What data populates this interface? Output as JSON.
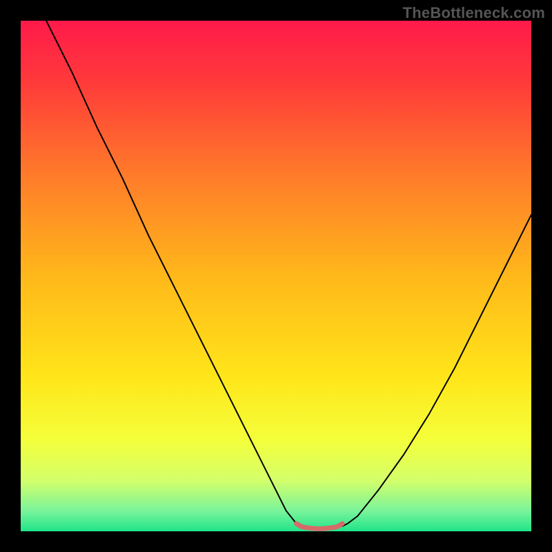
{
  "watermark": "TheBottleneck.com",
  "chart_data": {
    "type": "line",
    "title": "",
    "xlabel": "",
    "ylabel": "",
    "xlim": [
      0,
      100
    ],
    "ylim": [
      0,
      100
    ],
    "background_gradient": {
      "stops": [
        {
          "offset": 0.0,
          "color": "#ff1a4a"
        },
        {
          "offset": 0.12,
          "color": "#ff3a3a"
        },
        {
          "offset": 0.3,
          "color": "#ff7a2a"
        },
        {
          "offset": 0.5,
          "color": "#ffb81a"
        },
        {
          "offset": 0.7,
          "color": "#ffe61a"
        },
        {
          "offset": 0.82,
          "color": "#f4ff3a"
        },
        {
          "offset": 0.9,
          "color": "#d4ff6a"
        },
        {
          "offset": 0.96,
          "color": "#7af49a"
        },
        {
          "offset": 1.0,
          "color": "#20e48a"
        }
      ]
    },
    "series": [
      {
        "name": "curve-left",
        "stroke": "#000000",
        "stroke_width": 2,
        "x": [
          5,
          10,
          15,
          20,
          25,
          30,
          35,
          40,
          45,
          50,
          52,
          54,
          55
        ],
        "y": [
          100,
          90,
          79,
          69,
          58,
          48,
          38,
          28,
          18,
          8,
          4,
          1.5,
          1
        ]
      },
      {
        "name": "curve-right",
        "stroke": "#000000",
        "stroke_width": 2,
        "x": [
          63,
          64,
          66,
          70,
          75,
          80,
          85,
          90,
          95,
          100
        ],
        "y": [
          1,
          1.5,
          3,
          8,
          15,
          23,
          32,
          42,
          52,
          62
        ]
      },
      {
        "name": "valley-highlight",
        "stroke": "#d66a6a",
        "stroke_width": 7,
        "x": [
          54,
          55,
          56,
          57,
          58,
          59,
          60,
          61,
          62,
          63
        ],
        "y": [
          1.5,
          0.9,
          0.7,
          0.6,
          0.5,
          0.5,
          0.6,
          0.7,
          0.9,
          1.5
        ]
      }
    ]
  }
}
